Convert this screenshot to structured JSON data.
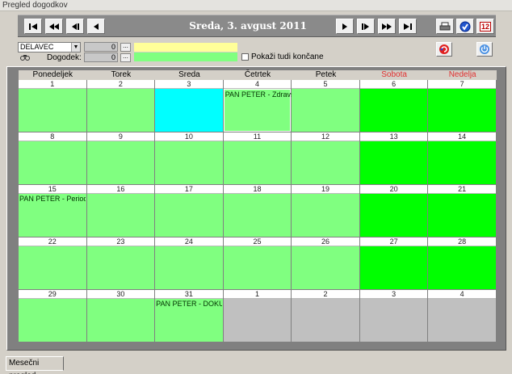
{
  "window": {
    "title": "Pregled dogodkov"
  },
  "nav": {
    "date_title": "Sreda,  3. avgust 2011",
    "btn_first": "first-icon",
    "btn_prev_fast": "prev-fast-icon",
    "btn_prev_step": "prev-step-icon",
    "btn_prev": "prev-icon",
    "btn_next": "next-icon",
    "btn_next_step": "next-step-icon",
    "btn_next_fast": "next-fast-icon",
    "btn_last": "last-icon"
  },
  "tools": {
    "date_icon_label": "12"
  },
  "filters": {
    "worker_select": "DELAVEC",
    "worker_id": "0",
    "dots": "...",
    "event_label": "Dogodek:",
    "event_id": "0",
    "show_finished_label": "Pokaži tudi končane",
    "worker_color": "#ffff99",
    "event_color": "#80ff80"
  },
  "calendar": {
    "days": [
      "Ponedeljek",
      "Torek",
      "Sreda",
      "Četrtek",
      "Petek",
      "Sobota",
      "Nedelja"
    ],
    "weeks": [
      [
        {
          "d": "1",
          "c": "#80ff80",
          "e": ""
        },
        {
          "d": "2",
          "c": "#80ff80",
          "e": ""
        },
        {
          "d": "3",
          "c": "#00ffff",
          "e": ""
        },
        {
          "d": "4",
          "c": "#80ff80",
          "e": "PAN PETER - Zdravs"
        },
        {
          "d": "5",
          "c": "#80ff80",
          "e": ""
        },
        {
          "d": "6",
          "c": "#00ff00",
          "e": ""
        },
        {
          "d": "7",
          "c": "#00ff00",
          "e": ""
        }
      ],
      [
        {
          "d": "8",
          "c": "#80ff80",
          "e": ""
        },
        {
          "d": "9",
          "c": "#80ff80",
          "e": ""
        },
        {
          "d": "10",
          "c": "#80ff80",
          "e": ""
        },
        {
          "d": "11",
          "c": "#80ff80",
          "e": ""
        },
        {
          "d": "12",
          "c": "#80ff80",
          "e": ""
        },
        {
          "d": "13",
          "c": "#00ff00",
          "e": ""
        },
        {
          "d": "14",
          "c": "#00ff00",
          "e": ""
        }
      ],
      [
        {
          "d": "15",
          "c": "#80ff80",
          "e": "PAN PETER - Period"
        },
        {
          "d": "16",
          "c": "#80ff80",
          "e": ""
        },
        {
          "d": "17",
          "c": "#80ff80",
          "e": ""
        },
        {
          "d": "18",
          "c": "#80ff80",
          "e": ""
        },
        {
          "d": "19",
          "c": "#80ff80",
          "e": ""
        },
        {
          "d": "20",
          "c": "#00ff00",
          "e": ""
        },
        {
          "d": "21",
          "c": "#00ff00",
          "e": ""
        }
      ],
      [
        {
          "d": "22",
          "c": "#80ff80",
          "e": ""
        },
        {
          "d": "23",
          "c": "#80ff80",
          "e": ""
        },
        {
          "d": "24",
          "c": "#80ff80",
          "e": ""
        },
        {
          "d": "25",
          "c": "#80ff80",
          "e": ""
        },
        {
          "d": "26",
          "c": "#80ff80",
          "e": ""
        },
        {
          "d": "27",
          "c": "#00ff00",
          "e": ""
        },
        {
          "d": "28",
          "c": "#00ff00",
          "e": ""
        }
      ],
      [
        {
          "d": "29",
          "c": "#80ff80",
          "e": ""
        },
        {
          "d": "30",
          "c": "#80ff80",
          "e": ""
        },
        {
          "d": "31",
          "c": "#80ff80",
          "e": "PAN PETER - DOKUM"
        },
        {
          "d": "1",
          "c": "#c0c0c0",
          "e": ""
        },
        {
          "d": "2",
          "c": "#c0c0c0",
          "e": ""
        },
        {
          "d": "3",
          "c": "#c0c0c0",
          "e": ""
        },
        {
          "d": "4",
          "c": "#c0c0c0",
          "e": ""
        }
      ]
    ]
  },
  "tabs": {
    "monthly": "Mesečni pregled"
  }
}
